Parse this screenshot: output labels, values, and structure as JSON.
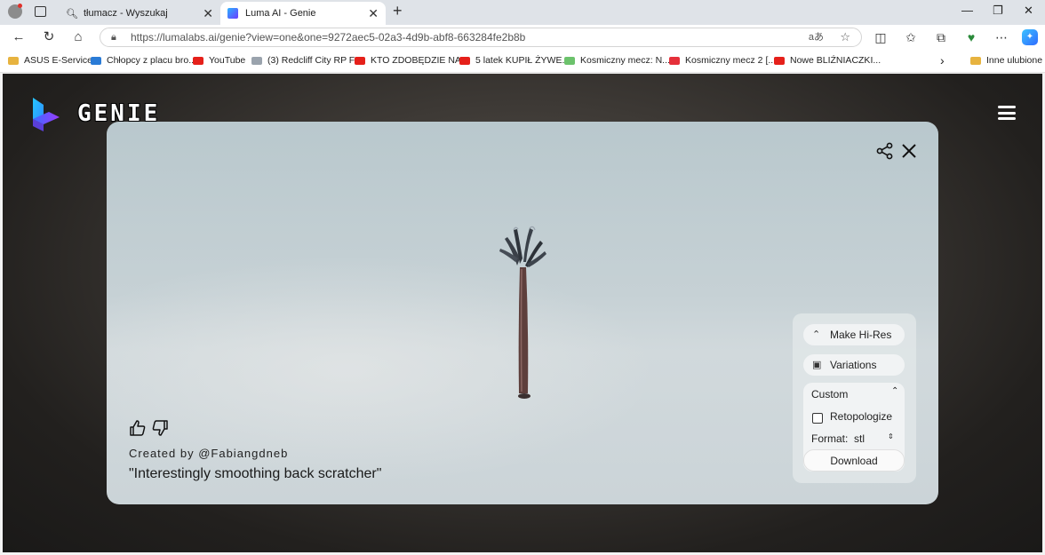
{
  "browser": {
    "tabs": [
      {
        "title": "tłumacz - Wyszukaj"
      },
      {
        "title": "Luma AI - Genie"
      }
    ],
    "url": "https://lumalabs.ai/genie?view=one&one=9272aec5-02a3-4d9b-abf8-663284fe2b8b",
    "bookmarks": [
      {
        "label": "ASUS E-Service",
        "icon": "folder"
      },
      {
        "label": "Chłopcy z placu bro...",
        "icon": "bing"
      },
      {
        "label": "YouTube",
        "icon": "youtube"
      },
      {
        "label": "(3) Redcliff City RP F...",
        "icon": "page"
      },
      {
        "label": "KTO ZDOBĘDZIE NA...",
        "icon": "youtube"
      },
      {
        "label": "5 latek KUPIŁ ŻYWE...",
        "icon": "youtube"
      },
      {
        "label": "Kosmiczny mecz: N...",
        "icon": "green"
      },
      {
        "label": "Kosmiczny mecz 2 [...",
        "icon": "red"
      },
      {
        "label": "Nowe BLIŹNIACZKI...",
        "icon": "youtube"
      }
    ],
    "other_favorites": "Inne ulubione"
  },
  "site": {
    "logo_text": "GENIE"
  },
  "card": {
    "created_by": "Created by @Fabiangdneb",
    "prompt": "\"Interestingly smoothing back scratcher\""
  },
  "panel": {
    "make_hires": "Make Hi-Res",
    "variations": "Variations",
    "preset": "Custom",
    "retopologize": "Retopologize",
    "format_label": "Format:",
    "format_value": "stl",
    "download": "Download"
  }
}
